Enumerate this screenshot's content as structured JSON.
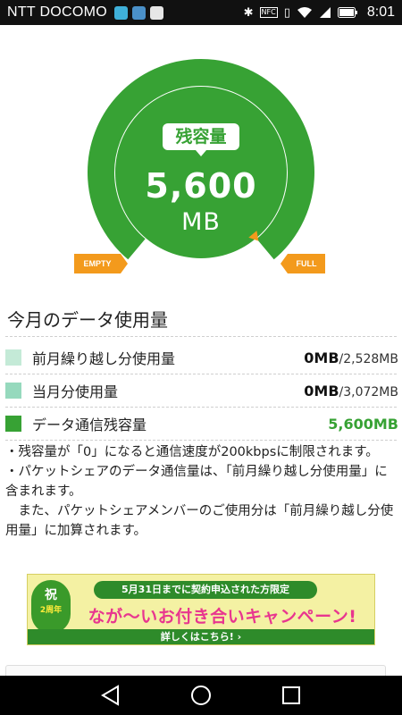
{
  "status_bar": {
    "carrier": "NTT DOCOMO",
    "time": "8:01",
    "icons": [
      "mail-icon",
      "image-icon",
      "store-icon",
      "bluetooth-icon",
      "nfc-icon",
      "vibrate-icon",
      "wifi-icon",
      "signal-icon",
      "battery-icon"
    ]
  },
  "gauge": {
    "label": "残容量",
    "value": "5,600",
    "unit": "MB",
    "empty_label": "EMPTY",
    "full_label": "FULL",
    "fill_fraction": 1.0,
    "colors": {
      "ring": "#37a234",
      "inner": "#37a234",
      "marker": "#f39a1c"
    }
  },
  "usage": {
    "title": "今月のデータ使用量",
    "rows": [
      {
        "label": "前月繰り越し分使用量",
        "used": "0MB",
        "total": "/2,528MB",
        "color": "#c4ead7"
      },
      {
        "label": "当月分使用量",
        "used": "0MB",
        "total": "/3,072MB",
        "color": "#96d9bd"
      },
      {
        "label": "データ通信残容量",
        "used": "5,600MB",
        "total": "",
        "color": "#37a234"
      }
    ]
  },
  "notes": [
    "・残容量が「0」になると通信速度が200kbpsに制限されます。",
    "・パケットシェアのデータ通信量は、「前月繰り越し分使用量」に含まれます。",
    "　また、パケットシェアメンバーのご使用分は「前月繰り越し分使用量」に加算されます。"
  ],
  "banner": {
    "badge_main": "祝",
    "badge_sub": "2周年",
    "top_text": "5月31日までに契約申込された方限定",
    "main_text": "なが〜いお付き合いキャンペーン!",
    "cta": "詳しくはこちら! ›"
  }
}
